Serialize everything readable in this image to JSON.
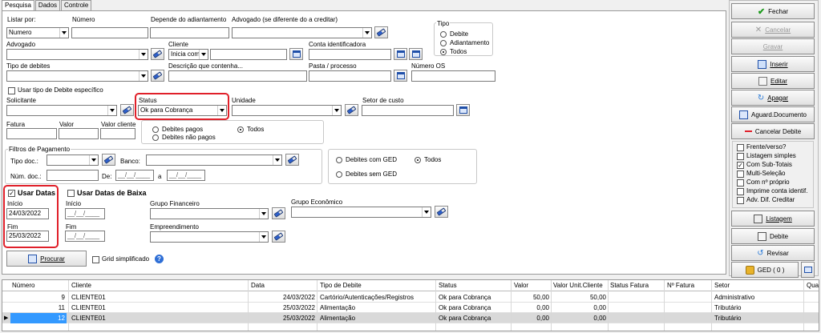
{
  "tabs": [
    "Pesquisa",
    "Dados",
    "Controle"
  ],
  "form": {
    "listar_por_label": "Listar por:",
    "listar_por_value": "Numero",
    "numero_label": "Número",
    "depende_label": "Depende do adiantamento",
    "advogado_creditar_label": "Advogado  (se diferente do a creditar)",
    "advogado_label": "Advogado",
    "cliente_label": "Cliente",
    "cliente_mode": "Inicia com",
    "conta_label": "Conta identificadora",
    "tipo_debites_label": "Tipo de debites",
    "descricao_label": "Descrição que contenha...",
    "pasta_label": "Pasta / processo",
    "numero_os_label": "Número OS",
    "usar_tipo_label": "Usar tipo de Debite específico",
    "solicitante_label": "Solicitante",
    "status_label": "Status",
    "status_value": "Ok para Cobrança",
    "unidade_label": "Unidade",
    "setor_label": "Setor de custo",
    "fatura_label": "Fatura",
    "valor_label": "Valor",
    "valor_cliente_label": "Valor cliente",
    "debites_pagos": "Debites pagos",
    "debites_nao_pagos": "Debites não pagos",
    "todos": "Todos",
    "filtros_label": "Filtros de Pagamento",
    "tipo_doc_label": "Tipo doc.:",
    "banco_label": "Banco:",
    "num_doc_label": "Núm. doc.:",
    "de_label": "De:",
    "a_label": "a",
    "date_blank": "__/__/____",
    "ged_com": "Debites com GED",
    "ged_sem": "Debites sem GED",
    "usar_datas_label": "Usar Datas",
    "usar_datas_baixa_label": "Usar Datas de Baixa",
    "inicio_label": "Início",
    "fim_label": "Fim",
    "inicio_value": "24/03/2022",
    "fim_value": "25/03/2022",
    "grupo_financeiro_label": "Grupo Financeiro",
    "grupo_economico_label": "Grupo Econômico",
    "empreendimento_label": "Empreendimento",
    "procurar_label": "Procurar",
    "grid_simplificado_label": "Grid simplificado"
  },
  "tipo_group": {
    "title": "Tipo",
    "options": [
      "Debite",
      "Adiantamento",
      "Todos"
    ],
    "selected": "Todos"
  },
  "side": {
    "fechar": "Fechar",
    "cancelar": "Cancelar",
    "gravar": "Gravar",
    "inserir": "Inserir",
    "editar": "Editar",
    "apagar": "Apagar",
    "aguard_documento": "Aguard.Documento",
    "cancelar_debite": "Cancelar Debite",
    "checks": [
      "Frente/verso?",
      "Listagem simples",
      "Com Sub-Totais",
      "Multi-Seleção",
      "Com nº próprio",
      "Imprime conta identif.",
      "Adv. Dif. Creditar"
    ],
    "checked": [
      "Com Sub-Totais"
    ],
    "listagem": "Listagem",
    "debite": "Debite",
    "revisar": "Revisar",
    "ged": "GED ( 0 )"
  },
  "grid": {
    "headers": [
      "Número",
      "Cliente",
      "Data",
      "Tipo de Debite",
      "Status",
      "Valor",
      "Valor Unit.Cliente",
      "Status Fatura",
      "Nº Fatura",
      "Setor",
      "Quan"
    ],
    "rows": [
      [
        "9",
        "CLIENTE01",
        "24/03/2022",
        "Cartório/Autenticações/Registros",
        "Ok para Cobrança",
        "50,00",
        "50,00",
        "",
        "",
        "Administrativo",
        ""
      ],
      [
        "11",
        "CLIENTE01",
        "25/03/2022",
        "Alimentação",
        "Ok para Cobrança",
        "0,00",
        "0,00",
        "",
        "",
        "Tributário",
        ""
      ],
      [
        "12",
        "CLIENTE01",
        "25/03/2022",
        "Alimentação",
        "Ok para Cobrança",
        "0,00",
        "0,00",
        "",
        "",
        "Tributário",
        ""
      ]
    ],
    "selected_row": 2
  },
  "colors": {
    "red_highlight": "#e0202a",
    "selection_blue": "#3399ff"
  }
}
